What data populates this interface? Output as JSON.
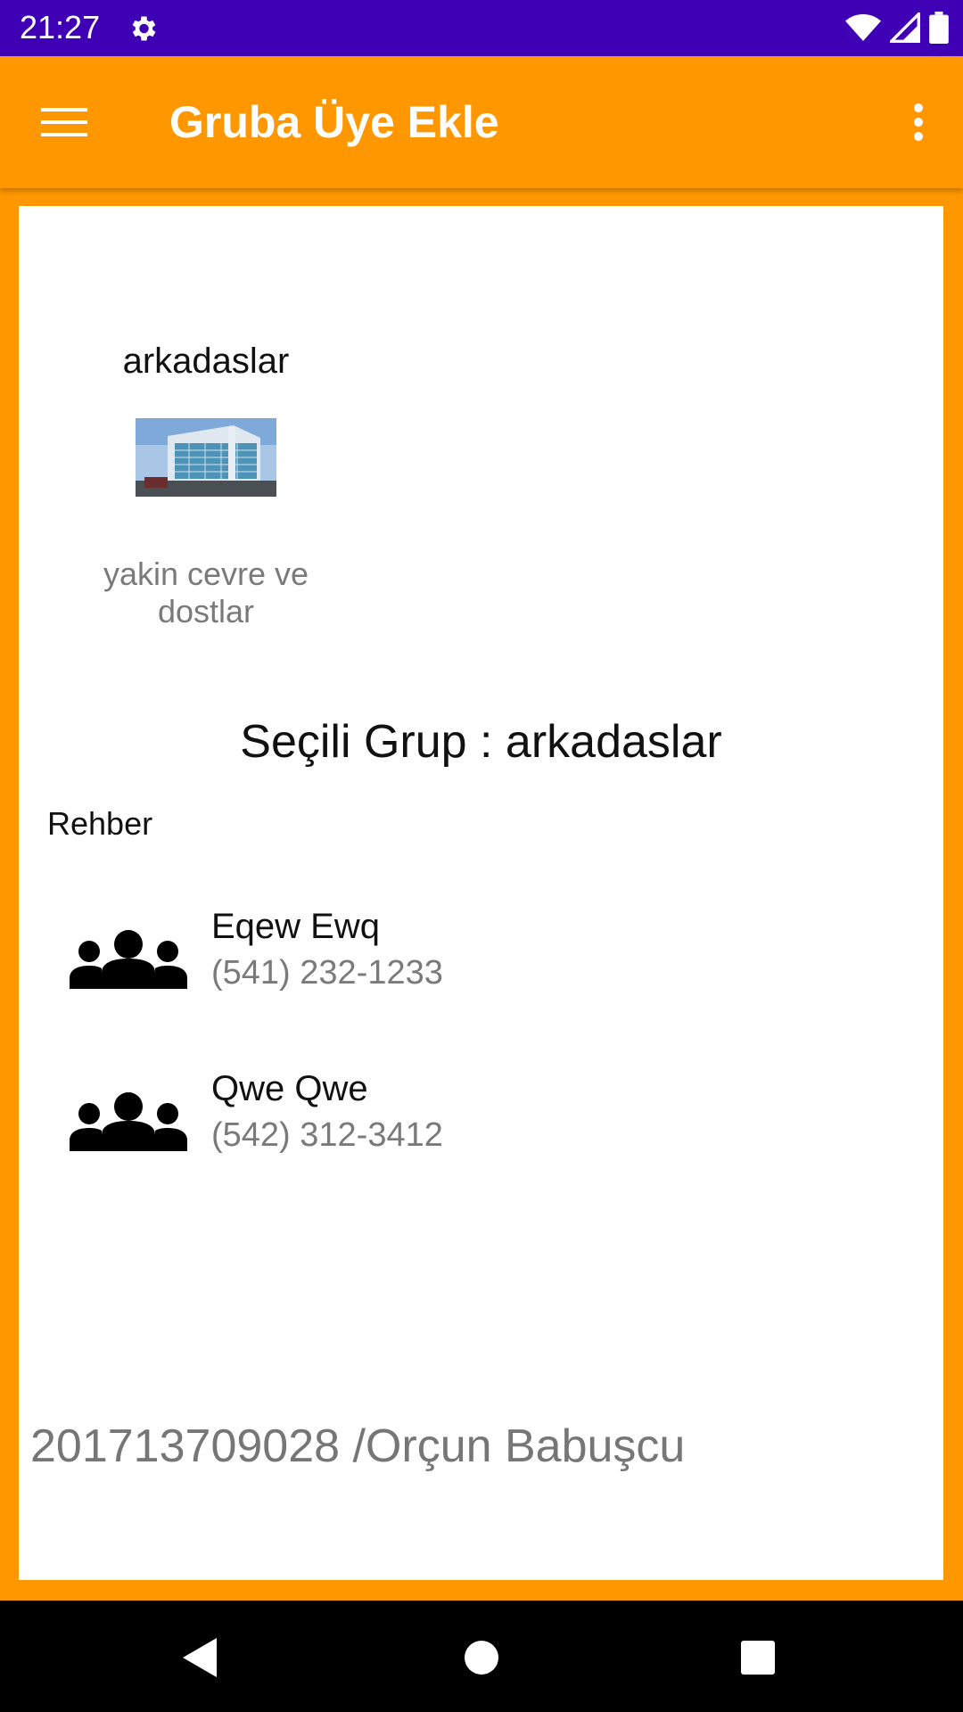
{
  "status_bar": {
    "time": "21:27"
  },
  "app_bar": {
    "title": "Gruba Üye Ekle"
  },
  "group": {
    "name": "arkadaslar",
    "description": "yakin cevre ve dostlar"
  },
  "selected_group_text": "Seçili Grup : arkadaslar",
  "contacts_section_label": "Rehber",
  "contacts": [
    {
      "name": "Eqew Ewq",
      "phone": "(541) 232-1233",
      "icon": "group-icon"
    },
    {
      "name": "Qwe Qwe",
      "phone": "(542) 312-3412",
      "icon": "group-icon"
    }
  ],
  "footer_credit": "201713709028 /Orçun Babuşcu",
  "colors": {
    "status_bar": "#3f00b5",
    "app_bar": "#ff9800",
    "card": "#ffffff",
    "muted_text": "#7a7a7a"
  },
  "icons": [
    "settings-gear-icon",
    "wifi-icon",
    "cell-signal-icon",
    "battery-icon",
    "hamburger-menu-icon",
    "overflow-menu-icon",
    "back-icon",
    "home-icon",
    "recents-icon"
  ]
}
